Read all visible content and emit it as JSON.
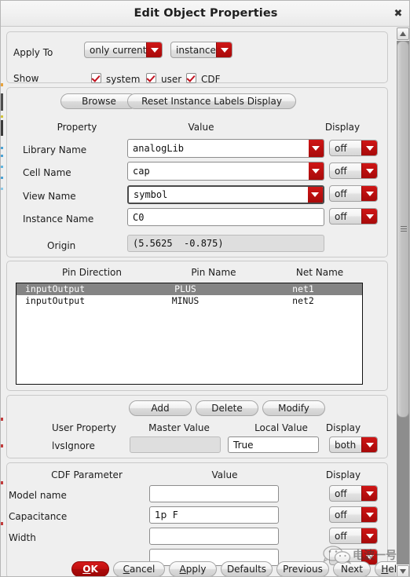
{
  "window": {
    "title": "Edit Object Properties",
    "close_icon": "close-icon"
  },
  "apply_section": {
    "apply_to_label": "Apply To",
    "scope_combo": {
      "value": "only current",
      "arrow_icon": "chevron-down-icon"
    },
    "object_combo": {
      "value": "instance",
      "arrow_icon": "chevron-down-icon"
    },
    "show_label": "Show",
    "checkboxes": [
      {
        "label": "system",
        "checked": true
      },
      {
        "label": "user",
        "checked": true
      },
      {
        "label": "CDF",
        "checked": true
      }
    ]
  },
  "property_section": {
    "browse_button": "Browse",
    "reset_button": "Reset Instance Labels Display",
    "headers": {
      "property": "Property",
      "value": "Value",
      "display": "Display"
    },
    "rows": [
      {
        "label": "Library Name",
        "value": "analogLib",
        "display": "off",
        "type": "combo",
        "focused": false
      },
      {
        "label": "Cell Name",
        "value": "cap",
        "display": "off",
        "type": "combo",
        "focused": false
      },
      {
        "label": "View Name",
        "value": "symbol",
        "display": "off",
        "type": "combo",
        "focused": true
      },
      {
        "label": "Instance Name",
        "value": "C0",
        "display": "off",
        "type": "text",
        "focused": false
      }
    ],
    "origin": {
      "label": "Origin",
      "value": "(5.5625  -0.875)"
    }
  },
  "pin_section": {
    "headers": {
      "direction": "Pin Direction",
      "pin_name": "Pin Name",
      "net_name": "Net Name"
    },
    "rows": [
      {
        "direction": "inputOutput",
        "pin_name": "PLUS",
        "net_name": "net1",
        "selected": true
      },
      {
        "direction": "inputOutput",
        "pin_name": "MINUS",
        "net_name": "net2",
        "selected": false
      }
    ]
  },
  "user_property_section": {
    "buttons": {
      "add": "Add",
      "delete": "Delete",
      "modify": "Modify"
    },
    "headers": {
      "user_property": "User Property",
      "master_value": "Master Value",
      "local_value": "Local Value",
      "display": "Display"
    },
    "rows": [
      {
        "name": "lvsIgnore",
        "master_value": "",
        "local_value": "True",
        "display": "both"
      }
    ]
  },
  "cdf_section": {
    "headers": {
      "parameter": "CDF Parameter",
      "value": "Value",
      "display": "Display"
    },
    "rows": [
      {
        "label": "Model name",
        "value": "",
        "display": "off"
      },
      {
        "label": "Capacitance",
        "value": "1p  F",
        "display": "off"
      },
      {
        "label": "Width",
        "value": "",
        "display": "off"
      }
    ]
  },
  "footer": {
    "buttons": [
      {
        "id": "ok",
        "label": "OK",
        "mnemonic": "O",
        "primary": true
      },
      {
        "id": "cancel",
        "label": "Cancel",
        "mnemonic": "C",
        "primary": false
      },
      {
        "id": "apply",
        "label": "Apply",
        "mnemonic": "A",
        "primary": false
      },
      {
        "id": "defaults",
        "label": "Defaults",
        "mnemonic": "",
        "primary": false
      },
      {
        "id": "previous",
        "label": "Previous",
        "mnemonic": "",
        "primary": false
      },
      {
        "id": "next",
        "label": "Next",
        "mnemonic": "",
        "primary": false
      },
      {
        "id": "help",
        "label": "Help",
        "mnemonic": "H",
        "primary": false
      }
    ]
  },
  "watermark": {
    "text": "电波一号",
    "icon": "wechat-icon"
  },
  "scrollbar": {
    "up_icon": "caret-up-icon",
    "down_icon": "caret-down-icon"
  }
}
